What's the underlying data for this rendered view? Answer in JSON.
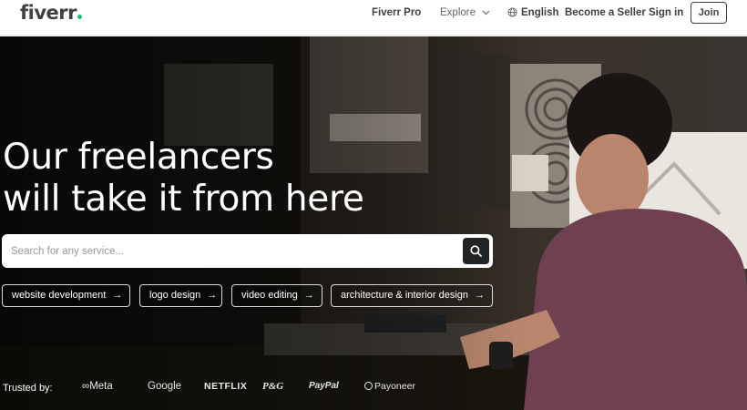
{
  "header": {
    "logo": "fiverr",
    "nav": {
      "pro": "Fiverr Pro",
      "explore": "Explore",
      "language": "English",
      "seller": "Become a Seller",
      "signin": "Sign in",
      "join": "Join"
    }
  },
  "hero": {
    "title_line1": "Our freelancers",
    "title_line2": "will take it from here",
    "search": {
      "placeholder": "Search for any service..."
    },
    "chips": [
      {
        "label": "website development"
      },
      {
        "label": "logo design"
      },
      {
        "label": "video editing"
      },
      {
        "label": "architecture & interior design"
      }
    ],
    "trusted_label": "Trusted by:",
    "brands": [
      "Meta",
      "Google",
      "NETFLIX",
      "P&G",
      "PayPal",
      "Payoneer"
    ]
  },
  "colors": {
    "brand_green": "#1dbf73",
    "text_dark": "#404145",
    "search_button": "#222325"
  }
}
